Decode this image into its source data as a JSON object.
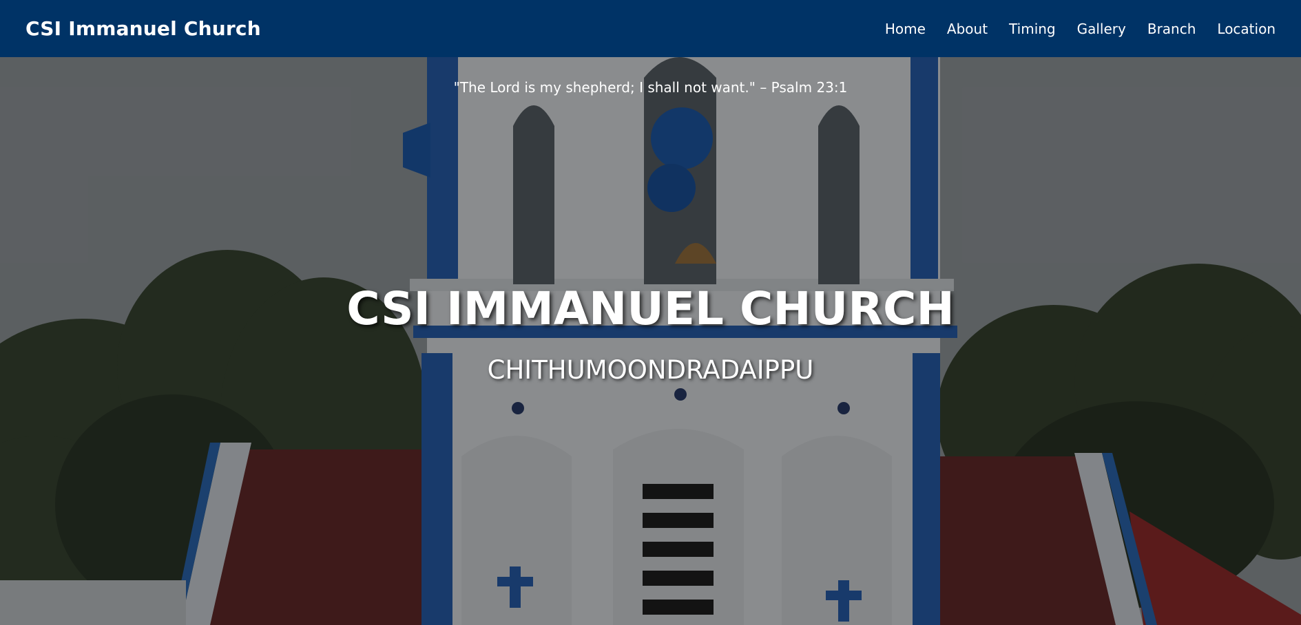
{
  "navbar": {
    "brand": "CSI Immanuel Church",
    "links": [
      "Home",
      "About",
      "Timing",
      "Gallery",
      "Branch",
      "Location"
    ],
    "background": "#003366"
  },
  "hero": {
    "verse": "\"The Lord is my shepherd; I shall not want.\" – Psalm 23:1",
    "title": "CSI IMMANUEL CHURCH",
    "subtitle": "CHITHUMOONDRADAIPPU",
    "image_description_icon": "church-bell-tower-photo"
  },
  "colors": {
    "accent_blue": "#1f5fb3",
    "roof": "#6b2a2a",
    "sky": "#9aa1a6"
  }
}
